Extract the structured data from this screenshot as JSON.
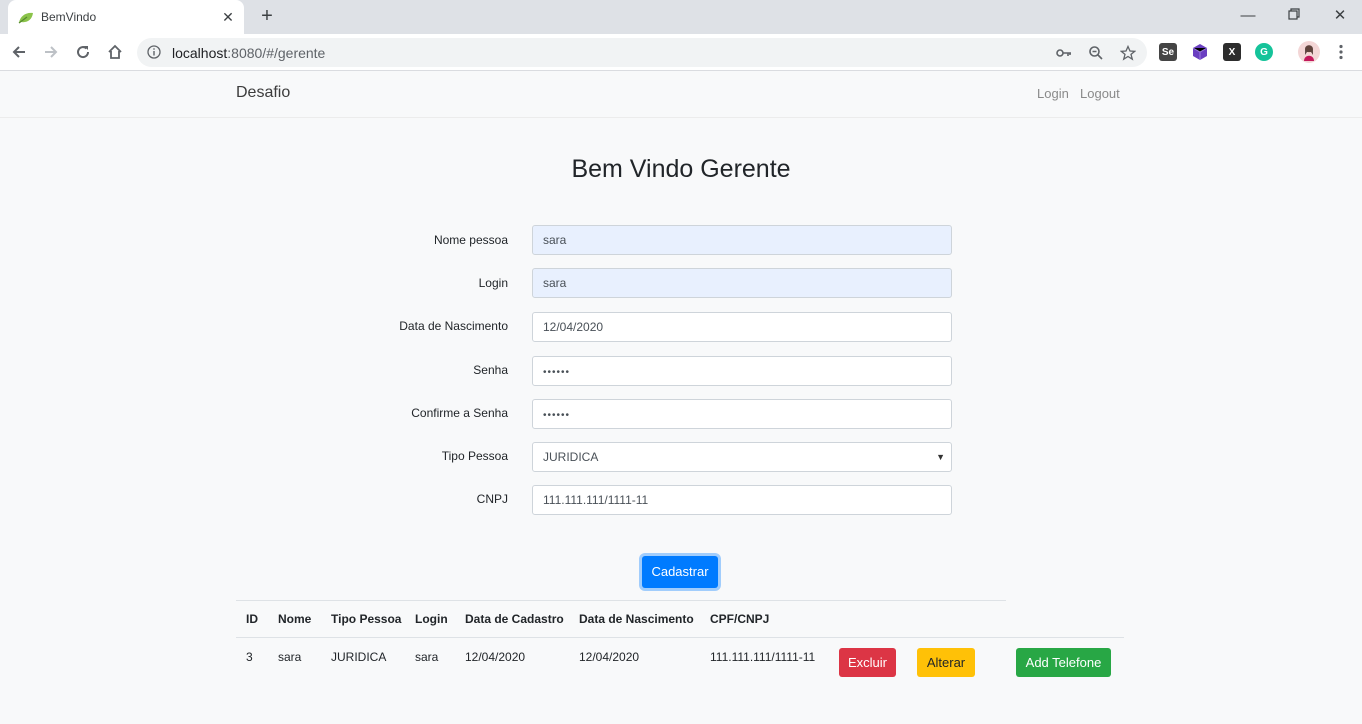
{
  "browser": {
    "tab_title": "BemVindo",
    "url_host": "localhost",
    "url_rest": ":8080/#/gerente"
  },
  "navbar": {
    "brand": "Desafio",
    "login": "Login",
    "logout": "Logout"
  },
  "page": {
    "title": "Bem Vindo Gerente"
  },
  "form": {
    "nome_label": "Nome pessoa",
    "nome_value": "sara",
    "login_label": "Login",
    "login_value": "sara",
    "nascimento_label": "Data de Nascimento",
    "nascimento_value": "12/04/2020",
    "senha_label": "Senha",
    "senha_value": "••••••",
    "confirme_label": "Confirme a Senha",
    "confirme_value": "••••••",
    "tipo_label": "Tipo Pessoa",
    "tipo_value": "JURIDICA",
    "cnpj_label": "CNPJ",
    "cnpj_value": "111.111.111/1111-11",
    "submit_label": "Cadastrar"
  },
  "table": {
    "headers": [
      "ID",
      "Nome",
      "Tipo Pessoa",
      "Login",
      "Data de Cadastro",
      "Data de Nascimento",
      "CPF/CNPJ"
    ],
    "rows": [
      {
        "id": "3",
        "nome": "sara",
        "tipo": "JURIDICA",
        "login": "sara",
        "cadastro": "12/04/2020",
        "nascimento": "12/04/2020",
        "documento": "111.111.111/1111-11",
        "excluir": "Excluir",
        "alterar": "Alterar",
        "add_telefone": "Add Telefone"
      }
    ]
  },
  "colors": {
    "primary": "#007bff",
    "danger": "#dc3545",
    "warning": "#ffc107",
    "success": "#28a745",
    "autofill": "#e8f0fe"
  },
  "icons": {
    "favicon": "leaf-icon",
    "back": "arrow-left-icon",
    "forward": "arrow-right-icon",
    "reload": "reload-icon",
    "home": "home-icon",
    "info": "info-icon",
    "key": "key-icon",
    "zoom": "zoom-icon",
    "star": "star-icon",
    "menu": "kebab-menu-icon"
  }
}
